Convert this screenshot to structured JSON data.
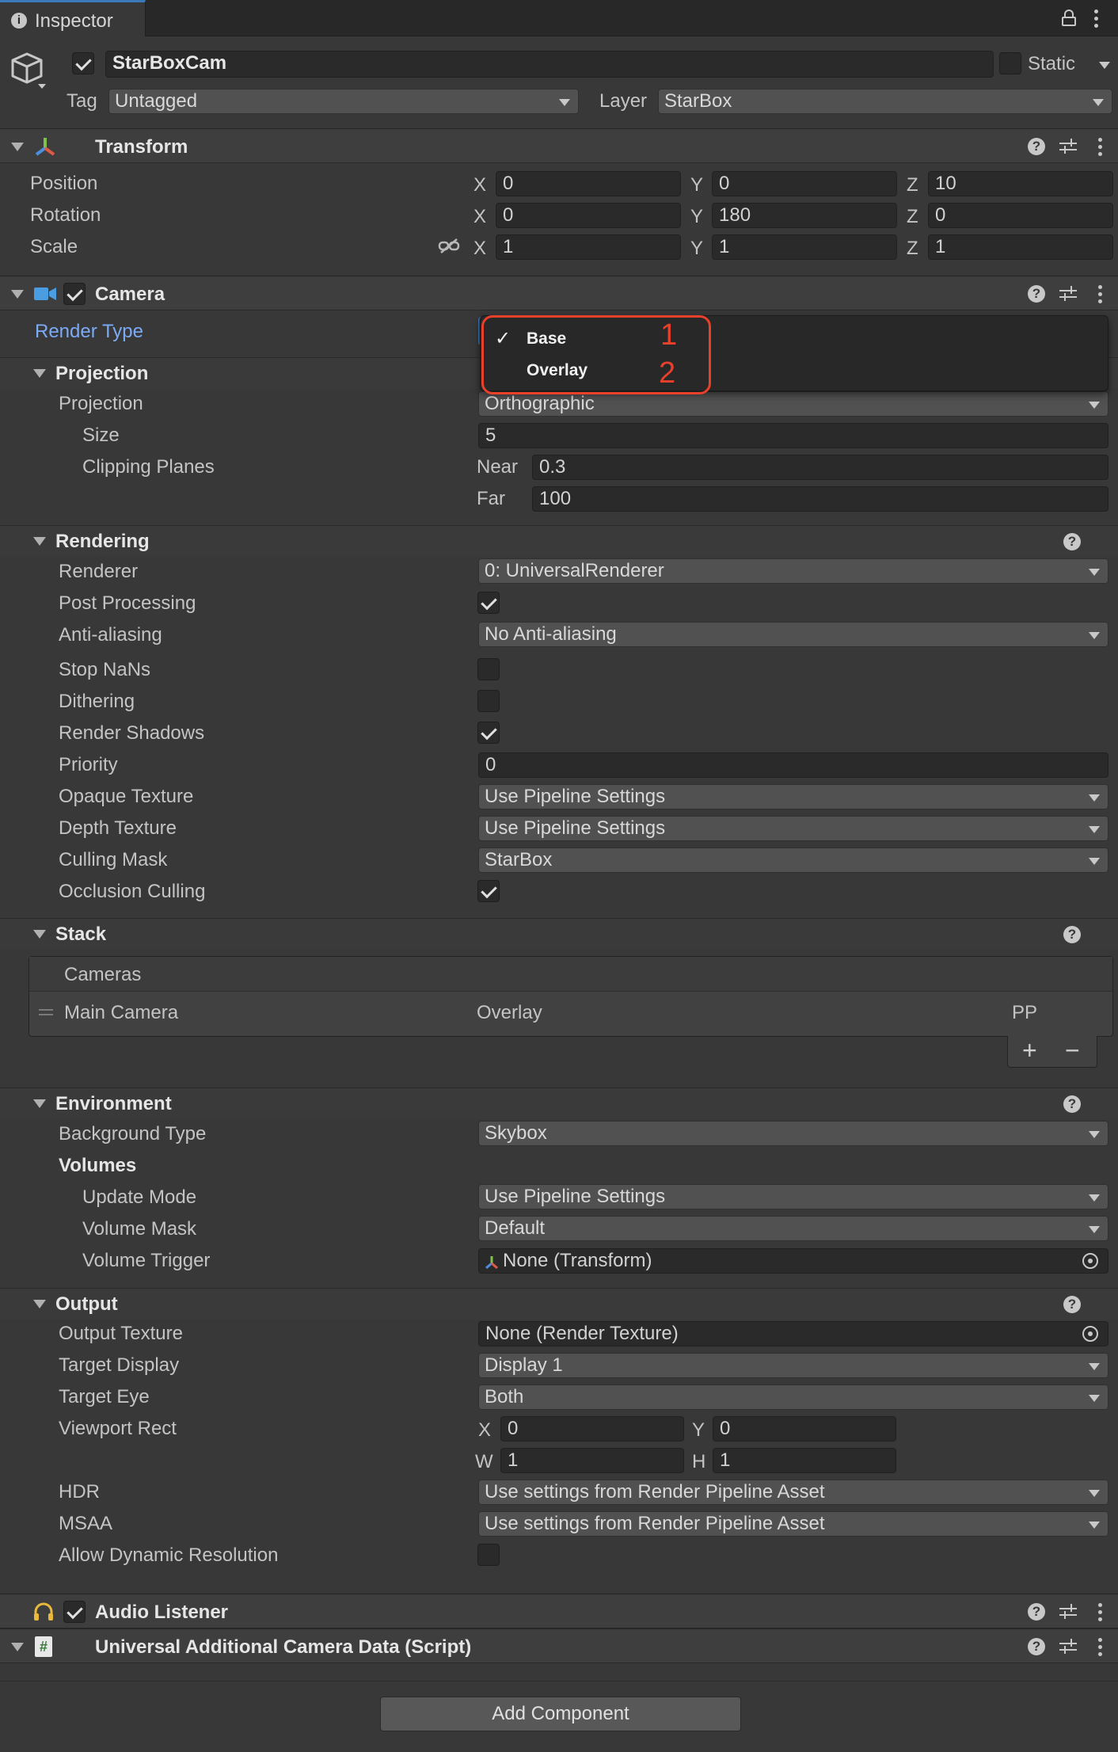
{
  "tab": {
    "title": "Inspector"
  },
  "object": {
    "name": "StarBoxCam",
    "static_label": "Static",
    "tag_label": "Tag",
    "tag_value": "Untagged",
    "layer_label": "Layer",
    "layer_value": "StarBox"
  },
  "transform": {
    "title": "Transform",
    "rows": [
      {
        "label": "Position",
        "x": "0",
        "y": "0",
        "z": "10"
      },
      {
        "label": "Rotation",
        "x": "0",
        "y": "180",
        "z": "0"
      },
      {
        "label": "Scale",
        "x": "1",
        "y": "1",
        "z": "1"
      }
    ],
    "axes": [
      "X",
      "Y",
      "Z"
    ]
  },
  "camera": {
    "title": "Camera",
    "render_type_label": "Render Type",
    "menu": {
      "items": [
        {
          "label": "Base",
          "checked": true
        },
        {
          "label": "Overlay",
          "checked": false
        }
      ],
      "annotations": [
        "1",
        "2"
      ]
    },
    "projection": {
      "section": "Projection",
      "label": "Projection",
      "value": "Orthographic",
      "size_label": "Size",
      "size_value": "5",
      "clip_label": "Clipping Planes",
      "near_label": "Near",
      "near_value": "0.3",
      "far_label": "Far",
      "far_value": "100"
    },
    "rendering": {
      "section": "Rendering",
      "renderer_label": "Renderer",
      "renderer_value": "0: UniversalRenderer",
      "post_label": "Post Processing",
      "aa_label": "Anti-aliasing",
      "aa_value": "No Anti-aliasing",
      "nan_label": "Stop NaNs",
      "dither_label": "Dithering",
      "shadows_label": "Render Shadows",
      "priority_label": "Priority",
      "priority_value": "0",
      "opaque_label": "Opaque Texture",
      "opaque_value": "Use Pipeline Settings",
      "depth_label": "Depth Texture",
      "depth_value": "Use Pipeline Settings",
      "culling_label": "Culling Mask",
      "culling_value": "StarBox",
      "occlusion_label": "Occlusion Culling"
    },
    "stack": {
      "section": "Stack",
      "list_header": "Cameras",
      "row_name": "Main Camera",
      "row_type": "Overlay",
      "row_pp": "PP",
      "add": "+",
      "remove": "−"
    },
    "environment": {
      "section": "Environment",
      "bg_label": "Background Type",
      "bg_value": "Skybox",
      "volumes_label": "Volumes",
      "update_label": "Update Mode",
      "update_value": "Use Pipeline Settings",
      "mask_label": "Volume Mask",
      "mask_value": "Default",
      "trigger_label": "Volume Trigger",
      "trigger_value": "None (Transform)"
    },
    "output": {
      "section": "Output",
      "tex_label": "Output Texture",
      "tex_value": "None (Render Texture)",
      "display_label": "Target Display",
      "display_value": "Display 1",
      "eye_label": "Target Eye",
      "eye_value": "Both",
      "rect_label": "Viewport Rect",
      "rect": {
        "x_label": "X",
        "x": "0",
        "y_label": "Y",
        "y": "0",
        "w_label": "W",
        "w": "1",
        "h_label": "H",
        "h": "1"
      },
      "hdr_label": "HDR",
      "hdr_value": "Use settings from Render Pipeline Asset",
      "msaa_label": "MSAA",
      "msaa_value": "Use settings from Render Pipeline Asset",
      "dyn_label": "Allow Dynamic Resolution"
    }
  },
  "audio": {
    "title": "Audio Listener"
  },
  "script": {
    "title": "Universal Additional Camera Data (Script)"
  },
  "footer": {
    "add_component": "Add Component"
  },
  "colors": {
    "accent_label": "#7baaf7",
    "annotation": "#e8402b",
    "bg": "#383838"
  }
}
